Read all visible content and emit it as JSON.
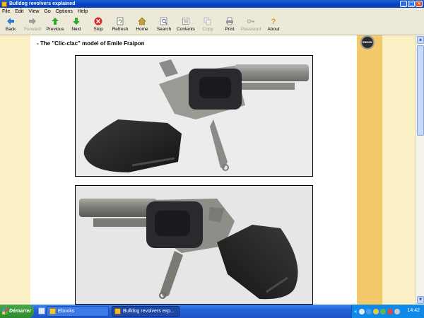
{
  "window": {
    "title": "Bulldog revolvers explained",
    "controls": [
      "minimize",
      "maximize",
      "close"
    ]
  },
  "menu": [
    "File",
    "Edit",
    "View",
    "Go",
    "Options",
    "Help"
  ],
  "toolbar": [
    {
      "label": "Back",
      "icon": "back-arrow-icon",
      "color": "#2a7bd8",
      "enabled": true
    },
    {
      "label": "Forward",
      "icon": "forward-arrow-icon",
      "color": "#9a9a9a",
      "enabled": false
    },
    {
      "label": "Previous",
      "icon": "up-arrow-icon",
      "color": "#2fa82f",
      "enabled": true
    },
    {
      "label": "Next",
      "icon": "down-arrow-icon",
      "color": "#2fa82f",
      "enabled": true
    },
    {
      "label": "Stop",
      "icon": "stop-icon",
      "color": "#d82828",
      "enabled": true
    },
    {
      "label": "Refresh",
      "icon": "refresh-icon",
      "color": "#3a8a3a",
      "enabled": true
    },
    {
      "label": "Home",
      "icon": "home-icon",
      "color": "#c8a038",
      "enabled": true
    },
    {
      "label": "Search",
      "icon": "search-icon",
      "color": "#5a6a8a",
      "enabled": true
    },
    {
      "label": "Contents",
      "icon": "contents-icon",
      "color": "#8a8a8a",
      "enabled": true
    },
    {
      "label": "Copy",
      "icon": "copy-icon",
      "color": "#a8a8a8",
      "enabled": false
    },
    {
      "label": "Print",
      "icon": "print-icon",
      "color": "#6a6a6a",
      "enabled": true
    },
    {
      "label": "Password",
      "icon": "key-icon",
      "color": "#a8a8a8",
      "enabled": false
    },
    {
      "label": "About",
      "icon": "help-icon",
      "color": "#c8a018",
      "enabled": true
    }
  ],
  "content": {
    "heading": "- The \"Clic-clac\" model of Emile Fraipon",
    "logo_text": "EBOOK"
  },
  "taskbar": {
    "start_label": "Démarrer",
    "tasks": [
      {
        "label": "Ebooks",
        "active": false
      },
      {
        "label": "Bulldog revolvers exp...",
        "active": true
      }
    ],
    "clock": "14:42"
  },
  "colors": {
    "page_bg": "#ffffff",
    "side_bg": "#fbefc6",
    "side_band": "#f4c96a",
    "taskbar": "#245edb",
    "titlebar": "#0a3fb8"
  }
}
